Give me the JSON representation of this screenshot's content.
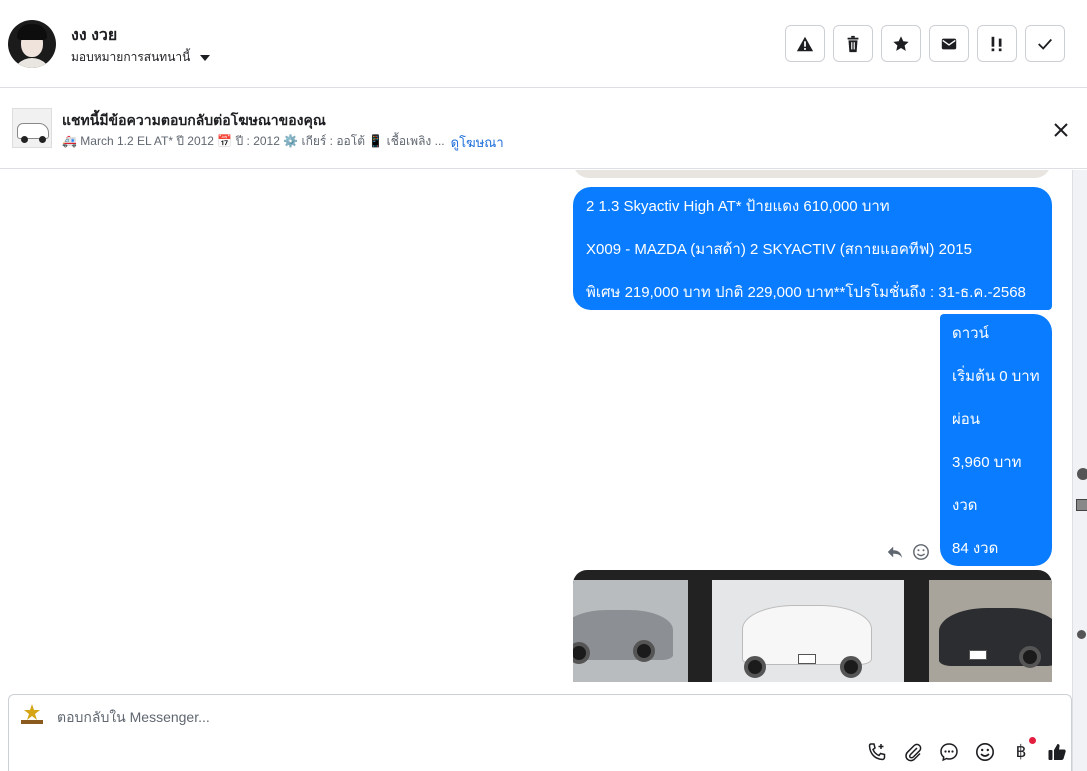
{
  "header": {
    "user_name": "งง งวย",
    "assign_label": "มอบหมายการสนทนานี้",
    "actions": [
      {
        "name": "report-spam-button",
        "icon": "warning-icon"
      },
      {
        "name": "delete-button",
        "icon": "trash-icon"
      },
      {
        "name": "star-button",
        "icon": "star-icon"
      },
      {
        "name": "mark-unread-button",
        "icon": "envelope-icon"
      },
      {
        "name": "follow-up-button",
        "icon": "exclamation-icon"
      },
      {
        "name": "mark-done-button",
        "icon": "check-icon"
      }
    ]
  },
  "ad_bar": {
    "title": "แชทนี้มีข้อความตอบกลับต่อโฆษณาของคุณ",
    "description": "🚑 March 1.2 EL AT* ปี 2012 📅 ปี : 2012 ⚙️ เกียร์ : ออโต้ 📱 เชื้อเพลิง ...",
    "link_label": "ดูโฆษณา"
  },
  "messages": [
    {
      "lines": [
        "2 1.3 Skyactiv High AT* ป้ายแดง 610,000 บาท",
        "X009 - MAZDA (มาสด้า) 2 SKYACTIV (สกายแอคทีฟ) 2015",
        "พิเศษ 219,000 บาท  ปกติ 229,000 บาท**โปรโมชั่นถึง : 31-ธ.ค.-2568"
      ]
    },
    {
      "lines": [
        "ดาวน์",
        "เริ่มต้น 0 บาท",
        "ผ่อน",
        "3,960 บาท",
        "งวด",
        "84 งวด"
      ]
    }
  ],
  "composer": {
    "placeholder": "ตอบกลับใน Messenger...",
    "tools": [
      "phone-icon",
      "paperclip-icon",
      "chat-bubble-icon",
      "emoji-icon",
      "baht-icon",
      "thumbs-up-icon"
    ],
    "baht_symbol": "฿"
  },
  "colors": {
    "bubble": "#0a7cff",
    "link": "#216fdb",
    "notification_dot": "#e41e3f"
  }
}
